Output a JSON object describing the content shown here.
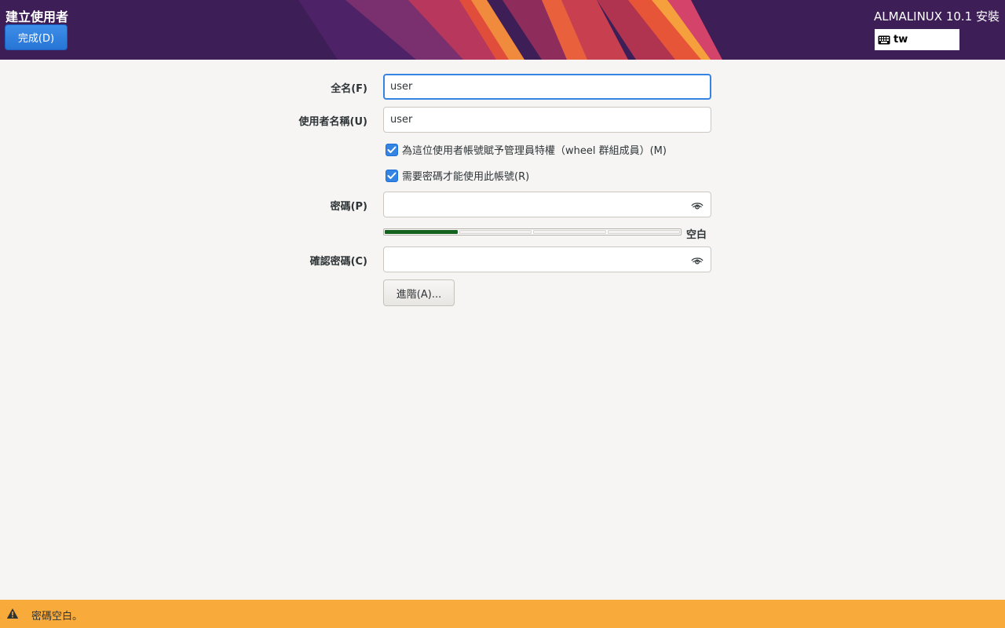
{
  "header": {
    "title": "建立使用者",
    "done_label": "完成(D)",
    "product_title": "ALMALINUX 10.1 安裝",
    "keyboard_layout": "tw",
    "keyboard_icon": "keyboard-icon"
  },
  "form": {
    "fullname_label": "全名(F)",
    "fullname_value": "user",
    "username_label": "使用者名稱(U)",
    "username_value": "user",
    "admin_checkbox_label": "為這位使用者帳號賦予管理員特權（wheel 群組成員）(M)",
    "admin_checked": true,
    "require_password_label": "需要密碼才能使用此帳號(R)",
    "require_password_checked": true,
    "password_label": "密碼(P)",
    "password_value": "",
    "strength_label": "空白",
    "strength_level": 0.25,
    "confirm_label": "確認密碼(C)",
    "confirm_value": "",
    "advanced_label": "進階(A)..."
  },
  "status": {
    "message": "密碼空白。",
    "icon": "warning-icon"
  },
  "colors": {
    "header_bg": "#3d1e57",
    "accent": "#3584e4",
    "status_bg": "#f8ab3b",
    "strength_fill": "#15621e"
  }
}
